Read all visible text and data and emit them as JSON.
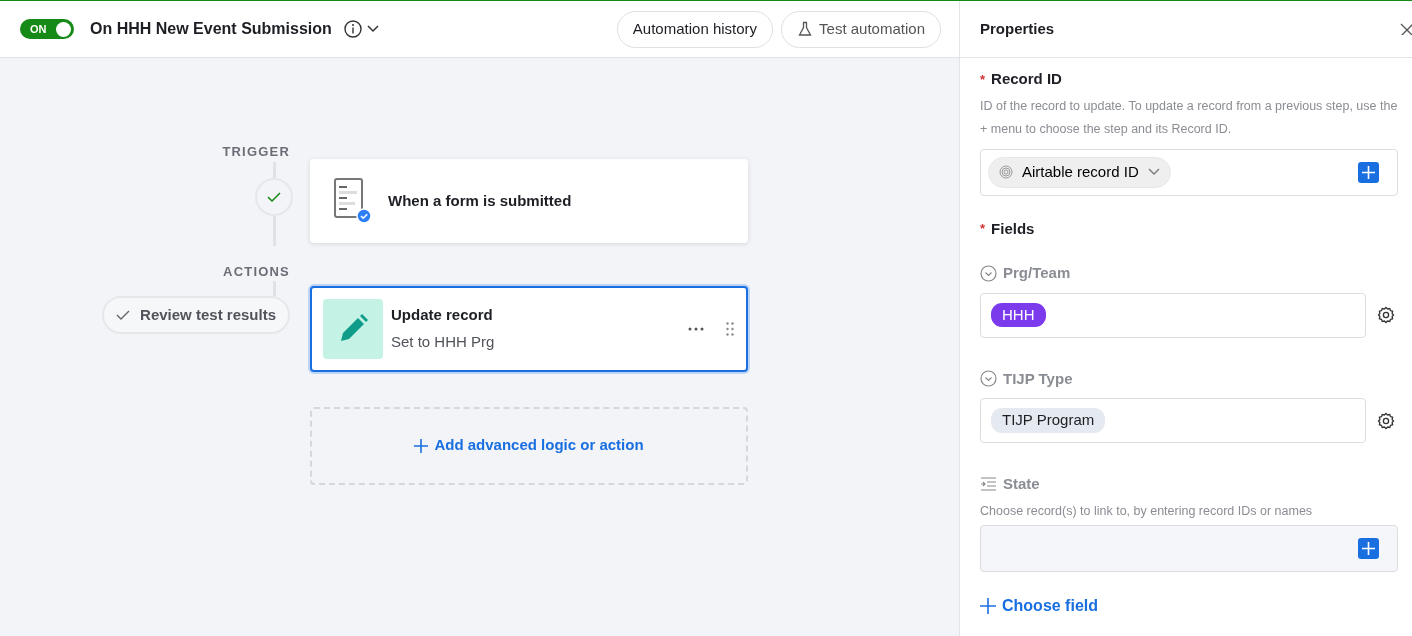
{
  "automation": {
    "enabled": true,
    "toggle_label": "ON",
    "title": "On HHH New Event Submission"
  },
  "header_buttons": [
    {
      "label": "Automation history",
      "kind": "plain"
    },
    {
      "label": "Test automation",
      "kind": "test"
    }
  ],
  "flow": {
    "trigger_label": "TRIGGER",
    "trigger_passed": true,
    "trigger": {
      "title": "When a form is submitted"
    },
    "actions_label": "ACTIONS",
    "review_button": "Review test results",
    "actions": [
      {
        "title": "Update record",
        "subtitle": "Set to HHH Prg",
        "selected": true
      }
    ],
    "add_button": "Add advanced logic or action"
  },
  "properties": {
    "title": "Properties",
    "required_mark": "*",
    "record_id": {
      "label": "Record ID",
      "required": true,
      "help": "ID of the record to update. To update a record from a previous step, use the + menu to choose the step and its Record ID.",
      "token": "Airtable record ID"
    },
    "fields_label": "Fields",
    "fields_required": true,
    "fields": [
      {
        "kind": "select",
        "name": "Prg/Team",
        "chips": [
          {
            "label": "HHH",
            "color": "#7c3aed"
          }
        ]
      },
      {
        "kind": "select",
        "name": "TIJP Type",
        "chips": [
          {
            "label": "TIJP Program",
            "color": "#e5e9f0"
          }
        ]
      },
      {
        "kind": "link",
        "name": "State",
        "help": "Choose record(s) to link to, by entering record IDs or names"
      }
    ],
    "choose_field": "Choose field"
  }
}
